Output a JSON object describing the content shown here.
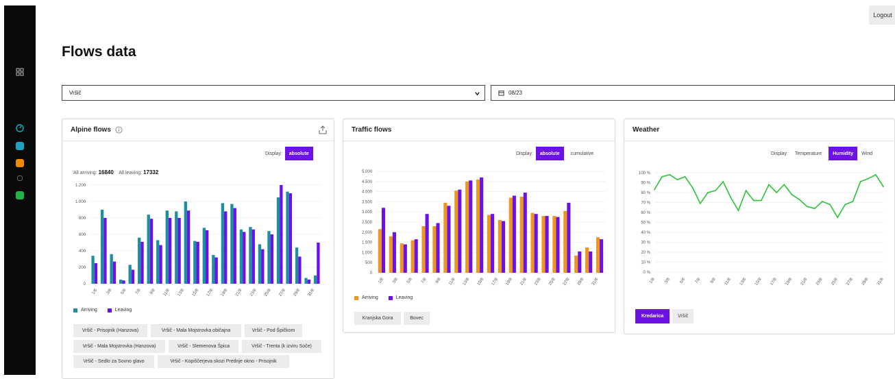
{
  "header": {
    "logout_label": "Logout",
    "title": "Flows data"
  },
  "filters": {
    "location_value": "Vršič",
    "date_value": "08/23"
  },
  "sidebar": {
    "items": [
      {
        "icon": "grid-icon",
        "color": "#9a9a9a"
      },
      {
        "icon": "gauge-icon",
        "color": "#00b3c4"
      },
      {
        "icon": "item-cyan-icon",
        "color": "#1fa3c2"
      },
      {
        "icon": "item-orange-icon",
        "color": "#f08a00"
      },
      {
        "icon": "item-gray-icon",
        "color": "#555555"
      },
      {
        "icon": "item-green-icon",
        "color": "#22b14c"
      }
    ]
  },
  "colors": {
    "accent": "#6c12e6",
    "arriving_alpine": "#1c8fa0",
    "leaving": "#6c12e6",
    "arriving_traffic": "#f0961e",
    "weather_line": "#27c437"
  },
  "alpine": {
    "title": "Alpine flows",
    "display_label": "Display:",
    "display_option": "absolute",
    "all_arriving_label": "All arriving:",
    "all_arriving_value": "16840",
    "all_leaving_label": "All leaving:",
    "all_leaving_value": "17332",
    "legend": [
      "Arriving",
      "Leaving"
    ],
    "chips": [
      "Vršič - Prisojnik (Hanzova)",
      "Vršič - Mala Mojstrovka običajna",
      "Vršič - Pod Špičkom",
      "Vršič - Mala Mojstrovka (Hanzova)",
      "Vršič - Slemenova Špica",
      "Vršič - Trenta (k izviru Soče)",
      "Vršič - Sedlo za Sovno glavo",
      "Vršič - Kopiščerjeva skozi Prednje okno - Prisojnik"
    ]
  },
  "traffic": {
    "title": "Traffic flows",
    "display_label": "Display:",
    "display_options": [
      "absolute",
      "cumulative"
    ],
    "legend": [
      "Arriving",
      "Leaving"
    ],
    "chips": [
      "Kranjska Gora",
      "Bovec"
    ]
  },
  "weather": {
    "title": "Weather",
    "display_label": "Display:",
    "display_options": [
      "Temperature",
      "Humidity",
      "Wind"
    ],
    "stations": [
      "Kredarica",
      "Vršič"
    ]
  },
  "chart_data": [
    {
      "type": "bar",
      "title": "Alpine flows",
      "categories": [
        "1/8",
        "3/8",
        "5/8",
        "7/8",
        "9/8",
        "11/8",
        "13/8",
        "15/8",
        "17/8",
        "19/8",
        "21/8",
        "23/8",
        "25/8",
        "27/8",
        "29/8",
        "31/8"
      ],
      "series": [
        {
          "name": "Arriving",
          "values": [
            340,
            900,
            360,
            50,
            230,
            560,
            840,
            530,
            890,
            880,
            1000,
            520,
            680,
            350,
            980,
            970,
            660,
            690,
            480,
            640,
            1050,
            1120,
            440,
            70,
            100
          ]
        },
        {
          "name": "Leaving",
          "values": [
            250,
            800,
            270,
            40,
            170,
            510,
            790,
            470,
            800,
            800,
            890,
            510,
            650,
            320,
            880,
            920,
            630,
            660,
            420,
            600,
            1200,
            1100,
            330,
            50,
            500
          ]
        }
      ],
      "y_ticks": [
        0,
        200,
        400,
        600,
        800,
        1000,
        1200
      ],
      "ylim": [
        0,
        1200
      ]
    },
    {
      "type": "bar",
      "title": "Traffic flows",
      "categories": [
        "1/8",
        "3/8",
        "5/8",
        "7/8",
        "9/8",
        "11/8",
        "13/8",
        "15/8",
        "17/8",
        "19/8",
        "21/8",
        "23/8",
        "25/8",
        "27/8",
        "29/8",
        "31/8"
      ],
      "series": [
        {
          "name": "Arriving",
          "values": [
            2150,
            1800,
            1450,
            1600,
            2300,
            2300,
            3450,
            4050,
            4500,
            4600,
            2850,
            2600,
            3700,
            3750,
            2950,
            2800,
            2800,
            3050,
            850,
            1250,
            1750
          ]
        },
        {
          "name": "Leaving",
          "values": [
            3200,
            2000,
            1400,
            1650,
            2900,
            2450,
            3300,
            4100,
            4550,
            4700,
            2900,
            2550,
            3800,
            3950,
            2900,
            2800,
            2750,
            3450,
            1050,
            1050,
            1650
          ]
        }
      ],
      "y_ticks": [
        0,
        500,
        1000,
        1500,
        2000,
        2500,
        3000,
        3500,
        4000,
        4500,
        5000
      ],
      "ylim": [
        0,
        5000
      ]
    },
    {
      "type": "line",
      "title": "Weather",
      "series": [
        {
          "name": "Humidity",
          "values": [
            83,
            96,
            98,
            93,
            96,
            85,
            69,
            80,
            82,
            91,
            75,
            62,
            82,
            72,
            72,
            88,
            80,
            88,
            78,
            73,
            66,
            64,
            71,
            68,
            55,
            68,
            71,
            91,
            94,
            98,
            86
          ]
        }
      ],
      "y_ticks": [
        0,
        10,
        20,
        30,
        40,
        50,
        60,
        70,
        80,
        90,
        100
      ],
      "y_tick_suffix": " %",
      "x_ticks": [
        "1/8",
        "3/8",
        "5/8",
        "7/8",
        "9/8",
        "11/8",
        "13/8",
        "15/8",
        "17/8",
        "19/8",
        "21/8",
        "23/8",
        "25/8",
        "27/8",
        "29/8",
        "31/8"
      ],
      "ylim": [
        0,
        100
      ]
    }
  ]
}
